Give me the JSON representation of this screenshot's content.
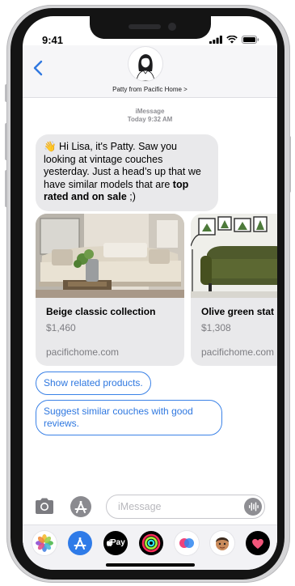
{
  "status_bar": {
    "time": "9:41"
  },
  "header": {
    "contact_name": "Patty from Pacific Home >"
  },
  "conversation": {
    "service": "iMessage",
    "timestamp": "Today 9:32 AM",
    "message": {
      "emoji": "👋",
      "text_before": " Hi Lisa, it's Patty. Saw you looking at vintage couches yesterday. Just a head’s up that we have similar models that are ",
      "bold": "top rated and on sale",
      "text_after": " ;)"
    },
    "cards": [
      {
        "title": "Beige classic collection",
        "price": "$1,460",
        "domain": "pacifichome.com"
      },
      {
        "title": "Olive green stat",
        "price": "$1,308",
        "domain": "pacifichome.com"
      }
    ],
    "quick_replies": [
      "Show related products.",
      "Suggest similar couches with good reviews."
    ]
  },
  "input": {
    "placeholder": "iMessage"
  },
  "app_drawer": {
    "apple_pay_label": "Pay",
    "apps": [
      "photos-icon",
      "app-store-icon",
      "apple-pay-icon",
      "activity-icon",
      "digital-touch-icon",
      "memoji-icon",
      "heart-stickers-icon"
    ]
  },
  "colors": {
    "link_blue": "#2f78e0",
    "bubble_gray": "#e9e9eb",
    "header_bg": "#f6f6f8"
  }
}
